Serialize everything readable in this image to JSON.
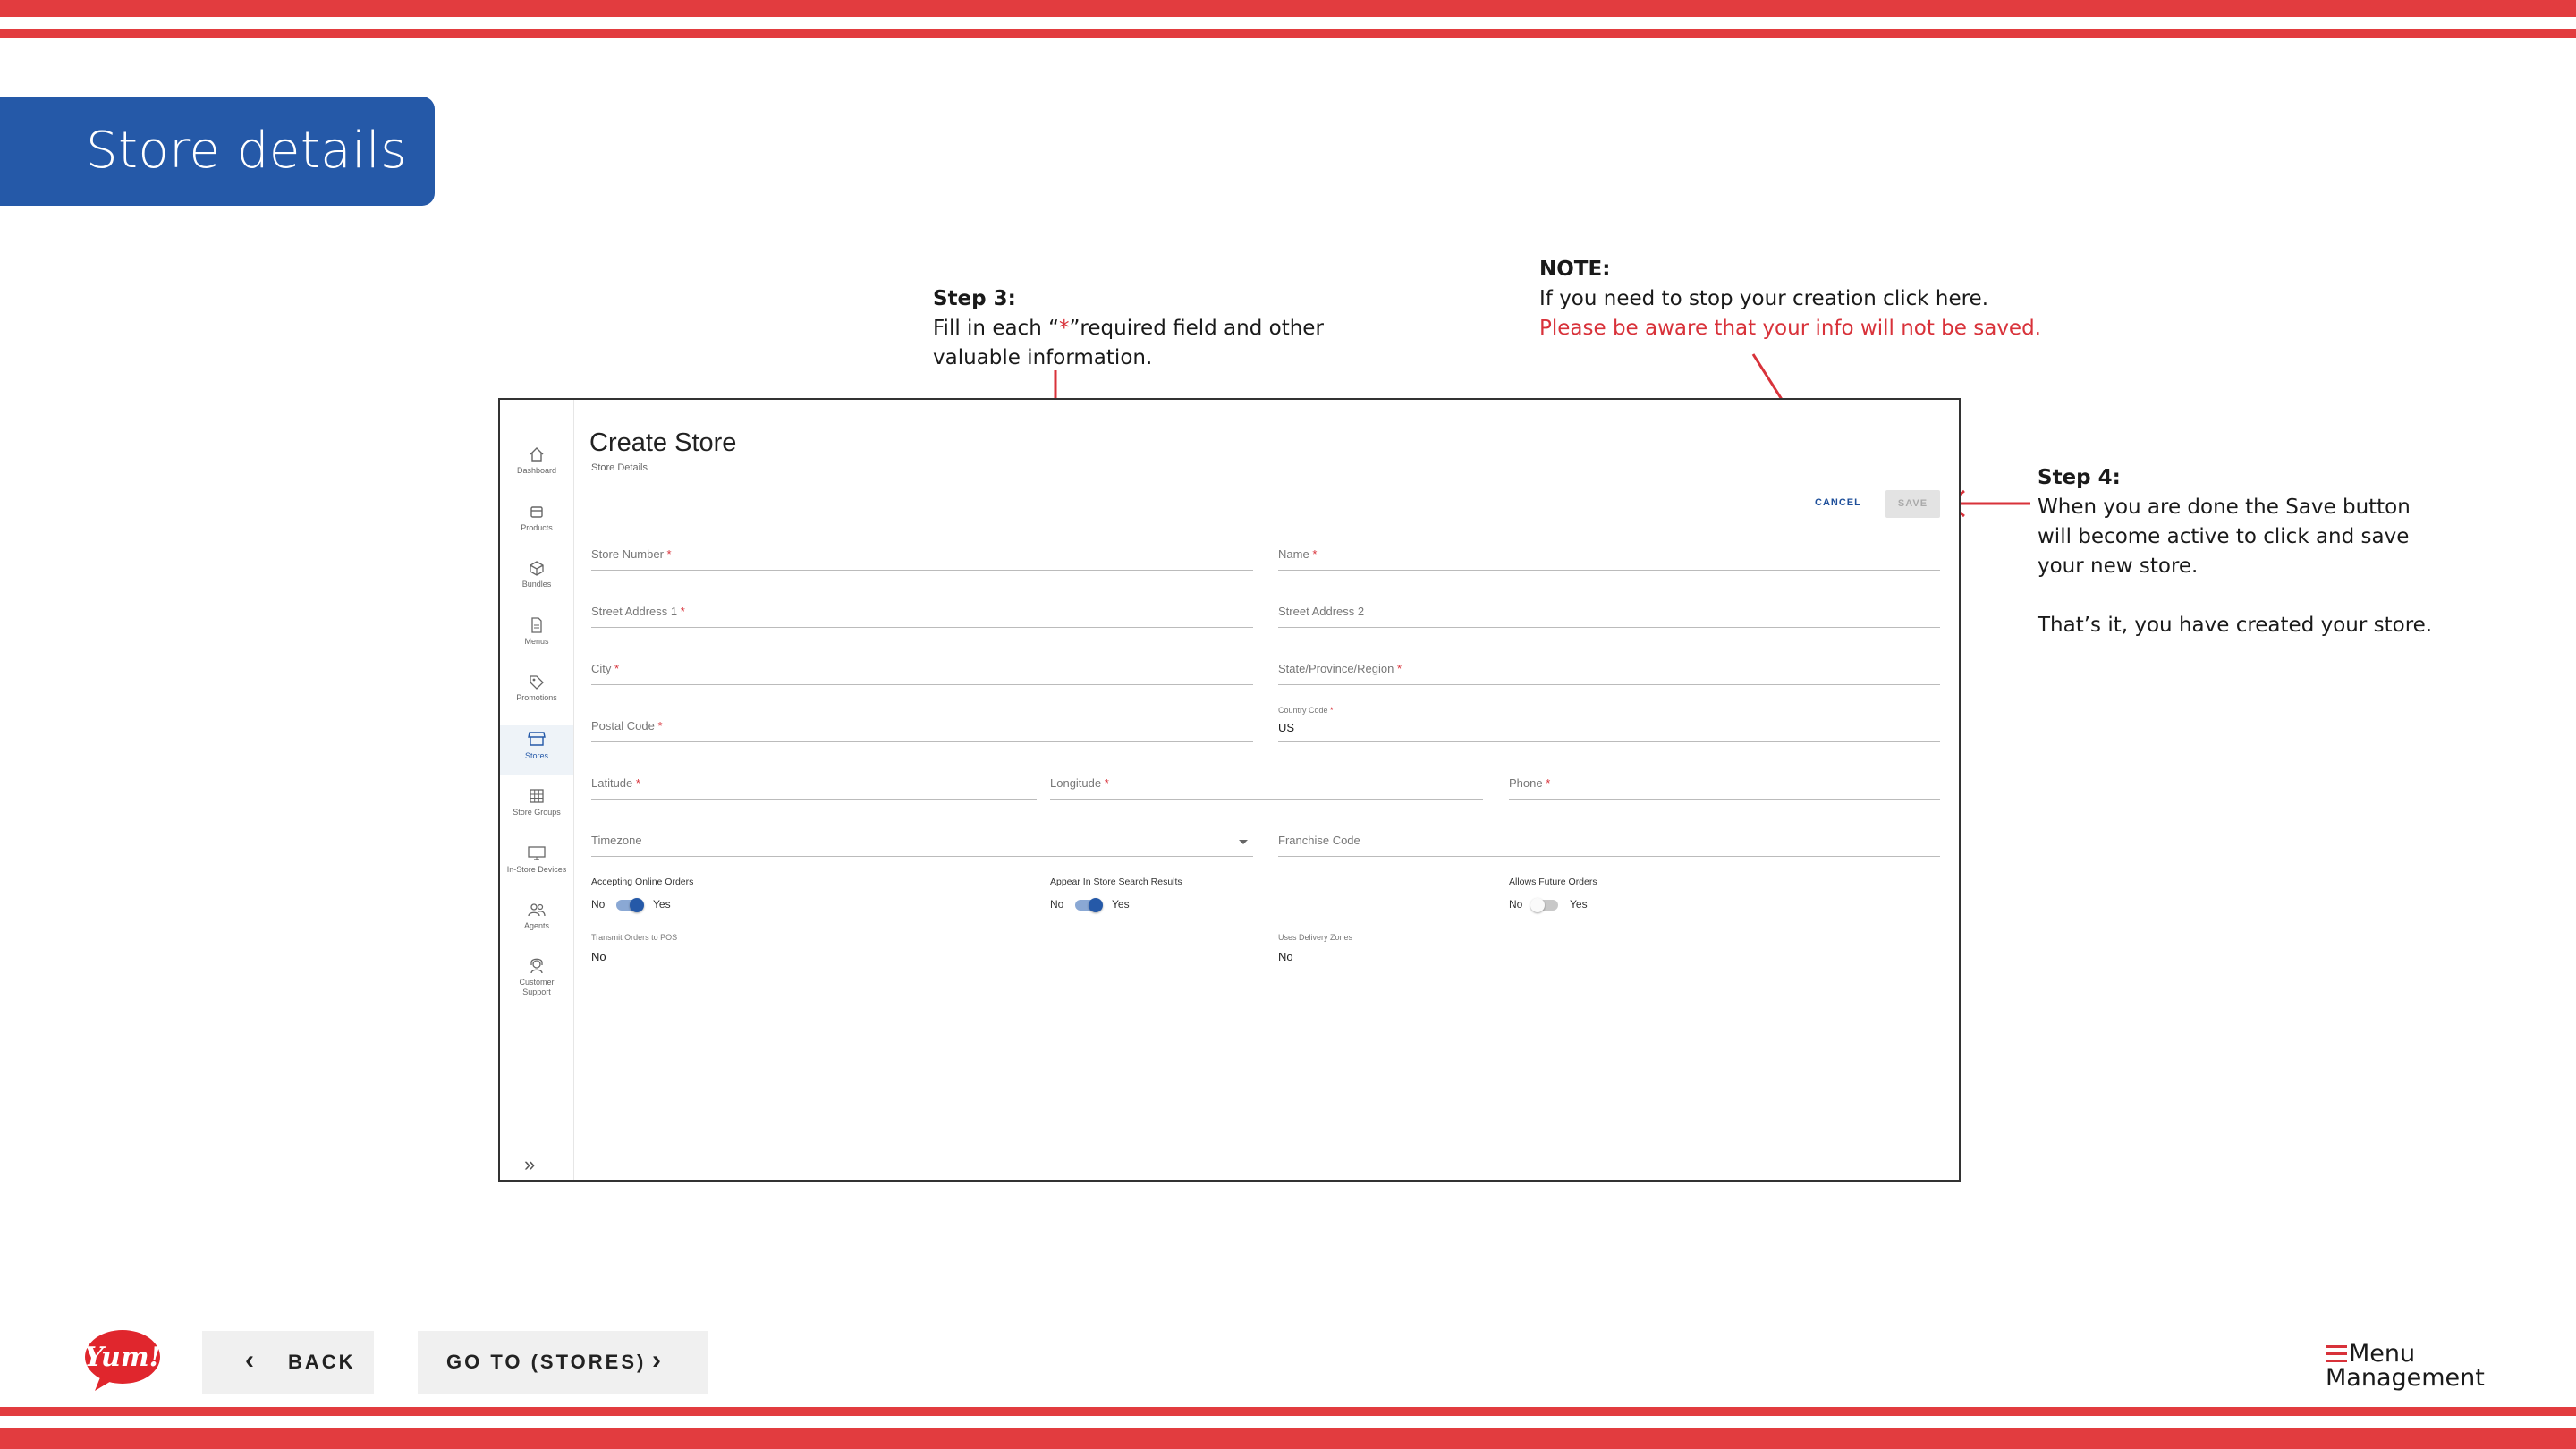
{
  "header": {
    "section_title": "Store details"
  },
  "callouts": {
    "step3": {
      "title": "Step 3:",
      "line1_pre": "Fill in each “",
      "line1_star": "*",
      "line1_post": "”required field and other",
      "line2": "valuable information."
    },
    "note": {
      "title": "NOTE:",
      "line1": "If you need to stop your creation click here.",
      "line2": "Please be aware that your info will not be saved."
    },
    "step4": {
      "title": "Step 4:",
      "line1": "When you are done the Save button",
      "line2": "will become active to click and save",
      "line3": "your new store.",
      "line4": "That’s it,  you have created your store."
    }
  },
  "app": {
    "sidebar": [
      {
        "label": "Dashboard",
        "icon": "home-icon"
      },
      {
        "label": "Products",
        "icon": "box-icon"
      },
      {
        "label": "Bundles",
        "icon": "cube-icon"
      },
      {
        "label": "Menus",
        "icon": "document-icon"
      },
      {
        "label": "Promotions",
        "icon": "tag-icon"
      },
      {
        "label": "Stores",
        "icon": "store-icon",
        "active": true
      },
      {
        "label": "Store Groups",
        "icon": "grid-icon"
      },
      {
        "label": "In-Store Devices",
        "icon": "monitor-icon"
      },
      {
        "label": "Agents",
        "icon": "people-icon"
      },
      {
        "label": "Customer",
        "label2": "Support",
        "icon": "support-icon"
      }
    ],
    "expand_glyph": "»",
    "title": "Create Store",
    "subtitle": "Store Details",
    "cancel": "CANCEL",
    "save": "SAVE",
    "fields": {
      "store_number": "Store Number",
      "name": "Name",
      "street1": "Street Address 1",
      "street2": "Street Address 2",
      "city": "City",
      "state": "State/Province/Region",
      "postal": "Postal Code",
      "country_label": "Country Code",
      "country_value": "US",
      "latitude": "Latitude",
      "longitude": "Longitude",
      "phone": "Phone",
      "timezone": "Timezone",
      "franchise": "Franchise Code"
    },
    "required_mark": "*",
    "toggles": [
      {
        "title": "Accepting Online Orders",
        "off": "No",
        "on": "Yes",
        "value": true
      },
      {
        "title": "Appear In Store Search Results",
        "off": "No",
        "on": "Yes",
        "value": true
      },
      {
        "title": "Allows Future Orders",
        "off": "No",
        "on": "Yes",
        "value": false
      }
    ],
    "readonly": [
      {
        "label": "Transmit Orders to POS",
        "value": "No"
      },
      {
        "label": "Uses Delivery Zones",
        "value": "No"
      }
    ]
  },
  "footer": {
    "logo_text": "Yum!",
    "back": "BACK",
    "goto": "GO TO (STORES)",
    "brand_line1": "Menu",
    "brand_line2": "Management"
  },
  "colors": {
    "stripe": "#e23c3f",
    "header_blue": "#2559a8",
    "accent_blue": "#1e4f9a",
    "toggle_on": "#2559a8"
  }
}
